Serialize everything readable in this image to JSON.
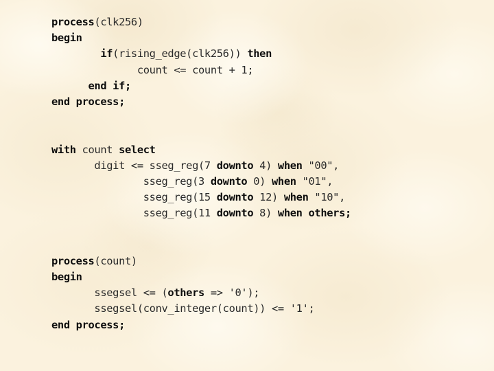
{
  "slide": {
    "background_color": "#fbf2de",
    "text_color": "#111111",
    "language": "VHDL",
    "code_lines": [
      {
        "indent": 0,
        "tokens": [
          {
            "t": "process",
            "b": true
          },
          {
            "t": "(clk256)",
            "b": false
          }
        ]
      },
      {
        "indent": 0,
        "tokens": [
          {
            "t": "begin",
            "b": true
          }
        ]
      },
      {
        "indent": 8,
        "tokens": [
          {
            "t": "if",
            "b": true
          },
          {
            "t": "(rising_edge(clk256)) ",
            "b": false
          },
          {
            "t": "then",
            "b": true
          }
        ]
      },
      {
        "indent": 14,
        "tokens": [
          {
            "t": "count <= count + 1;",
            "b": false
          }
        ]
      },
      {
        "indent": 6,
        "tokens": [
          {
            "t": "end if;",
            "b": true
          }
        ]
      },
      {
        "indent": 0,
        "tokens": [
          {
            "t": "end process;",
            "b": true
          }
        ]
      },
      {
        "indent": 0,
        "tokens": []
      },
      {
        "indent": 0,
        "tokens": []
      },
      {
        "indent": 0,
        "tokens": [
          {
            "t": "with ",
            "b": true
          },
          {
            "t": "count ",
            "b": false
          },
          {
            "t": "select",
            "b": true
          }
        ]
      },
      {
        "indent": 7,
        "tokens": [
          {
            "t": "digit <= sseg_reg(7 ",
            "b": false
          },
          {
            "t": "downto",
            "b": true
          },
          {
            "t": " 4) ",
            "b": false
          },
          {
            "t": "when",
            "b": true
          },
          {
            "t": " \"00\",",
            "b": false
          }
        ]
      },
      {
        "indent": 15,
        "tokens": [
          {
            "t": "sseg_reg(3 ",
            "b": false
          },
          {
            "t": "downto",
            "b": true
          },
          {
            "t": " 0) ",
            "b": false
          },
          {
            "t": "when",
            "b": true
          },
          {
            "t": " \"01\",",
            "b": false
          }
        ]
      },
      {
        "indent": 15,
        "tokens": [
          {
            "t": "sseg_reg(15 ",
            "b": false
          },
          {
            "t": "downto",
            "b": true
          },
          {
            "t": " 12) ",
            "b": false
          },
          {
            "t": "when",
            "b": true
          },
          {
            "t": " \"10\",",
            "b": false
          }
        ]
      },
      {
        "indent": 15,
        "tokens": [
          {
            "t": "sseg_reg(11 ",
            "b": false
          },
          {
            "t": "downto",
            "b": true
          },
          {
            "t": " 8) ",
            "b": false
          },
          {
            "t": "when others;",
            "b": true
          }
        ]
      },
      {
        "indent": 0,
        "tokens": []
      },
      {
        "indent": 0,
        "tokens": []
      },
      {
        "indent": 0,
        "tokens": [
          {
            "t": "process",
            "b": true
          },
          {
            "t": "(count)",
            "b": false
          }
        ]
      },
      {
        "indent": 0,
        "tokens": [
          {
            "t": "begin",
            "b": true
          }
        ]
      },
      {
        "indent": 7,
        "tokens": [
          {
            "t": "ssegsel <= (",
            "b": false
          },
          {
            "t": "others",
            "b": true
          },
          {
            "t": " => '0');",
            "b": false
          }
        ]
      },
      {
        "indent": 7,
        "tokens": [
          {
            "t": "ssegsel(conv_integer(count)) <= '1';",
            "b": false
          }
        ]
      },
      {
        "indent": 0,
        "tokens": [
          {
            "t": "end process;",
            "b": true
          }
        ]
      }
    ],
    "plain_text": "process(clk256)\nbegin\n        if(rising_edge(clk256)) then\n              count <= count + 1;\n      end if;\nend process;\n\n\nwith count select\n       digit <= sseg_reg(7 downto 4) when \"00\",\n               sseg_reg(3 downto 0) when \"01\",\n               sseg_reg(15 downto 12) when \"10\",\n               sseg_reg(11 downto 8) when others;\n\n\nprocess(count)\nbegin\n       ssegsel <= (others => '0');\n       ssegsel(conv_integer(count)) <= '1';\nend process;"
  }
}
